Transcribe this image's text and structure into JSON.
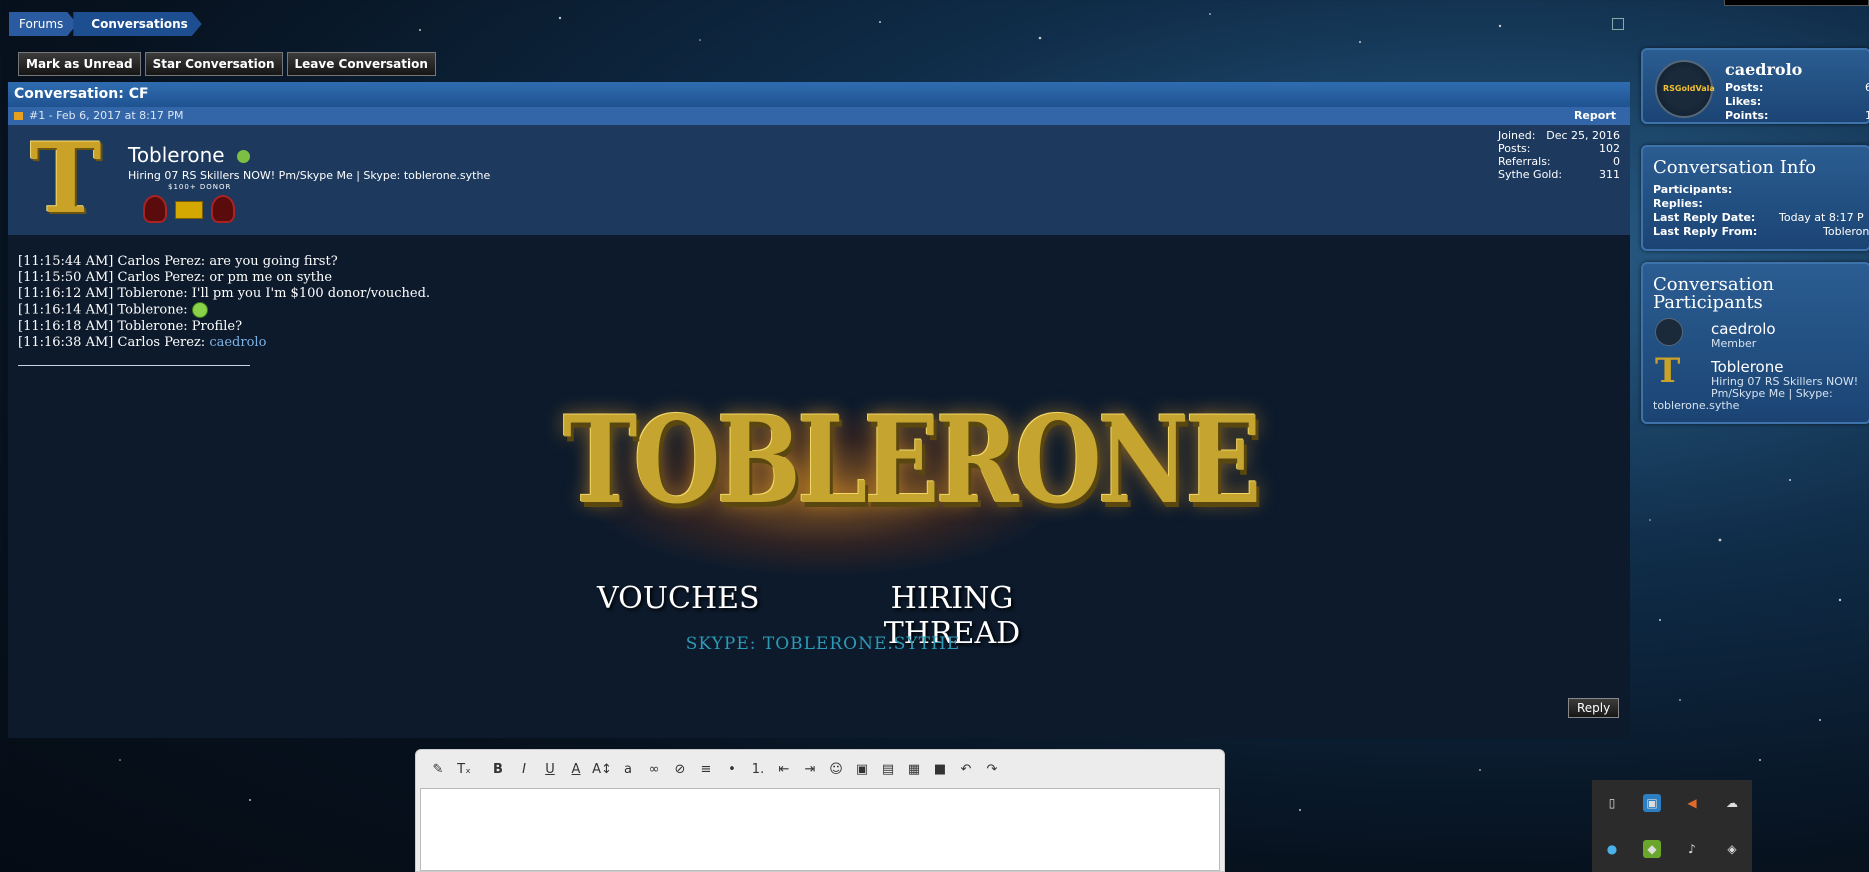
{
  "breadcrumb": {
    "forums": "Forums",
    "conversations": "Conversations"
  },
  "actions": {
    "mark_unread": "Mark as Unread",
    "star": "Star Conversation",
    "leave": "Leave Conversation"
  },
  "conversation": {
    "title": "Conversation: CF",
    "post_meta": "#1 - Feb 6, 2017 at 8:17 PM",
    "report": "Report",
    "username": "Toblerone",
    "avatar_letter": "T",
    "user_title": "Hiring 07 RS Skillers NOW! Pm/Skype Me | Skype: toblerone.sythe",
    "badge_label": "$100+ DONOR",
    "stats": [
      {
        "label": "Joined:",
        "value": "Dec 25, 2016"
      },
      {
        "label": "Posts:",
        "value": "102"
      },
      {
        "label": "Referrals:",
        "value": "0"
      },
      {
        "label": "Sythe Gold:",
        "value": "311"
      }
    ],
    "messages": [
      "[11:15:44 AM] Carlos Perez: are you going first?",
      "[11:15:50 AM] Carlos Perez: or pm me on sythe",
      "[11:16:12 AM] Toblerone: I'll pm you I'm $100 donor/vouched.",
      "[11:16:14 AM] Toblerone: ",
      "[11:16:18 AM] Toblerone: Profile?",
      "[11:16:38 AM] Carlos Perez: "
    ],
    "message_link": "caedrolo",
    "banner": {
      "title": "TOBLERONE",
      "vouches": "VOUCHES",
      "hiring": "HIRING THREAD",
      "skype": "SKYPE: TOBLERONE.SYTHE"
    },
    "reply": "Reply"
  },
  "sidebar": {
    "user": {
      "username": "caedrolo",
      "avatar_text": "RSGoldVala",
      "posts_label": "Posts:",
      "posts_value": "6",
      "likes_label": "Likes:",
      "likes_value": "",
      "points_label": "Points:",
      "points_value": "1"
    },
    "info": {
      "heading": "Conversation Info",
      "participants_label": "Participants:",
      "replies_label": "Replies:",
      "last_reply_date_label": "Last Reply Date:",
      "last_reply_date_value": "Today at 8:17 P",
      "last_reply_from_label": "Last Reply From:",
      "last_reply_from_value": "Toblerone"
    },
    "participants": {
      "heading_line1": "Conversation",
      "heading_line2": "Participants",
      "items": [
        {
          "name": "caedrolo",
          "role": "Member"
        },
        {
          "name": "Toblerone",
          "desc1": "Hiring 07 RS Skillers NOW!",
          "desc2": "Pm/Skype Me | Skype:",
          "desc3": "toblerone.sythe"
        }
      ]
    }
  }
}
